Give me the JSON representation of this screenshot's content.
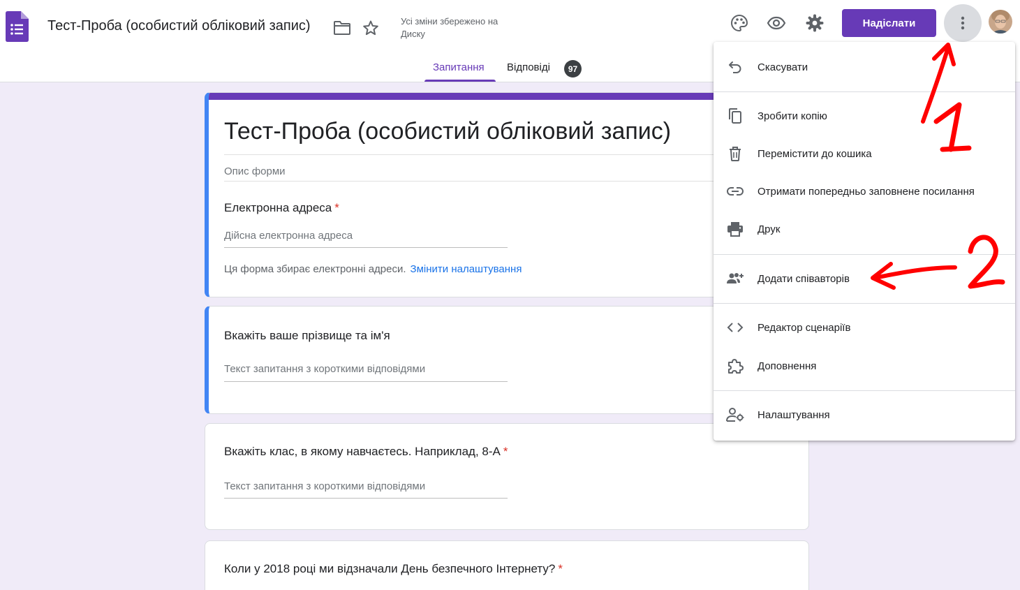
{
  "header": {
    "doc_title": "Тест-Проба (особистий обліковий запис)",
    "save_status": "Усі зміни збережено на Диску",
    "send_label": "Надіслати"
  },
  "tabs": {
    "questions_label": "Запитання",
    "responses_label": "Відповіді",
    "responses_count": "97"
  },
  "form": {
    "title": "Тест-Проба (особистий обліковий запис)",
    "description_placeholder": "Опис форми",
    "email_question": {
      "label": "Електронна адреса",
      "required_mark": "*",
      "placeholder": "Дійсна електронна адреса",
      "note": "Ця форма збирає електронні адреси.",
      "note_link": "Змінити налаштування"
    },
    "questions": [
      {
        "label": "Вкажіть ваше прізвище та ім'я",
        "required_mark": "",
        "placeholder": "Текст запитання з короткими відповідями"
      },
      {
        "label": "Вкажіть клас, в якому навчаєтесь. Наприклад, 8-А",
        "required_mark": "*",
        "placeholder": "Текст запитання з короткими відповідями"
      },
      {
        "label": "Коли у 2018 році ми відзначали День безпечного Інтернету?",
        "required_mark": "*"
      }
    ]
  },
  "menu": {
    "items": [
      {
        "label": "Скасувати",
        "icon": "undo-icon"
      },
      {
        "label": "Зробити копію",
        "icon": "copy-icon"
      },
      {
        "label": "Перемістити до кошика",
        "icon": "trash-icon"
      },
      {
        "label": "Отримати попередньо заповнене посилання",
        "icon": "link-icon"
      },
      {
        "label": "Друк",
        "icon": "print-icon"
      },
      {
        "label": "Додати співавторів",
        "icon": "add-people-icon"
      },
      {
        "label": "Редактор сценаріїв",
        "icon": "code-icon"
      },
      {
        "label": "Доповнення",
        "icon": "puzzle-icon"
      },
      {
        "label": "Налаштування",
        "icon": "person-settings-icon"
      }
    ]
  },
  "annotations": {
    "numbers": [
      "1",
      "2"
    ],
    "color": "#ff0000"
  },
  "colors": {
    "accent": "#673ab7",
    "background": "#f0ebf8",
    "active_border": "#4285f4",
    "link": "#1a73e8",
    "required": "#d93025"
  }
}
